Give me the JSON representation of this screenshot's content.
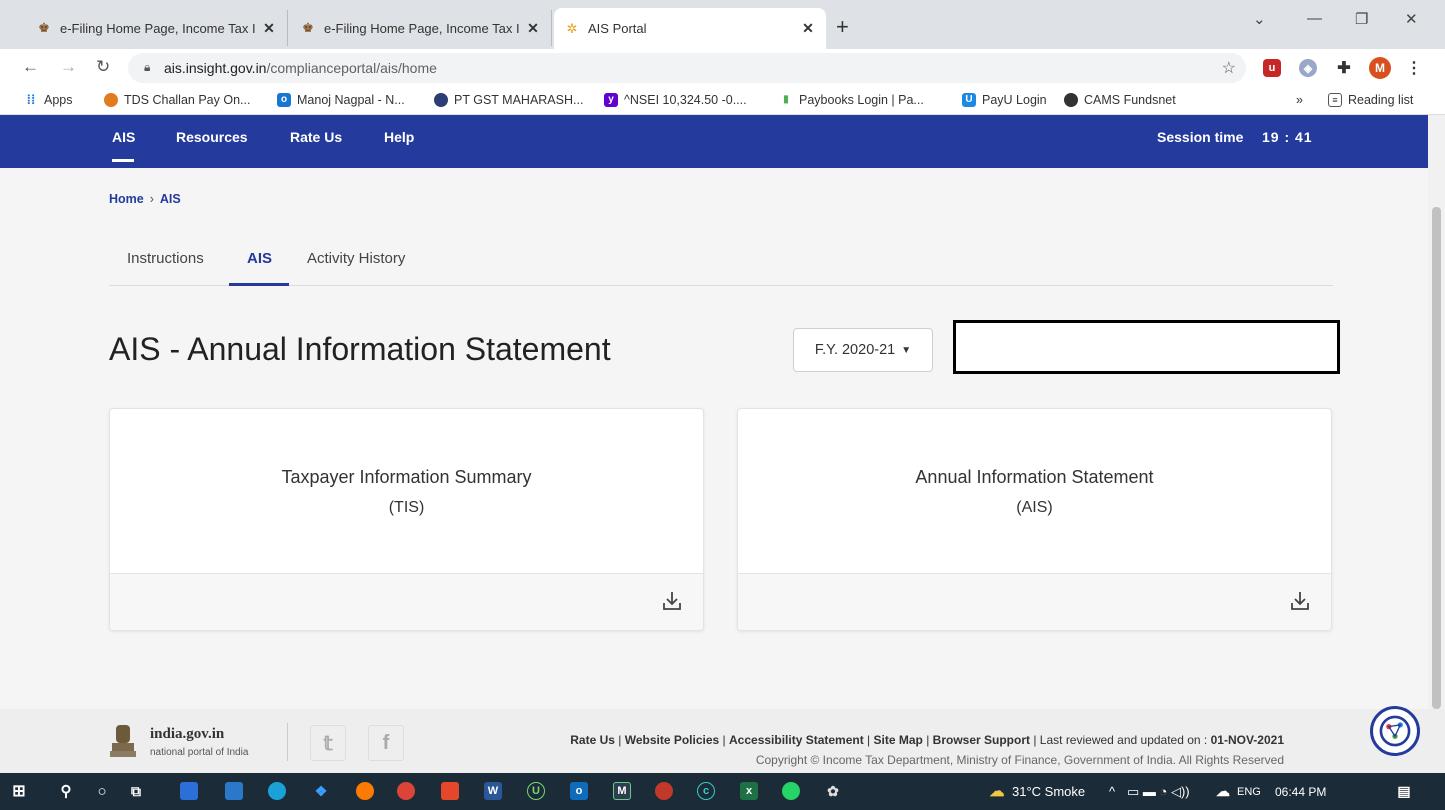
{
  "browser": {
    "tabs": [
      {
        "title": "e-Filing Home Page, Income Tax I",
        "active": false
      },
      {
        "title": "e-Filing Home Page, Income Tax I",
        "active": false
      },
      {
        "title": "AIS Portal",
        "active": true
      }
    ],
    "url_domain": "ais.insight.gov.in",
    "url_path": "/complianceportal/ais/home",
    "profile_initial": "M",
    "bookmarks": [
      {
        "label": "Apps"
      },
      {
        "label": "TDS Challan Pay On..."
      },
      {
        "label": "Manoj Nagpal - N..."
      },
      {
        "label": "PT GST MAHARASH..."
      },
      {
        "label": "^NSEI 10,324.50 -0...."
      },
      {
        "label": "Paybooks Login | Pa..."
      },
      {
        "label": "PayU Login"
      },
      {
        "label": "CAMS Fundsnet"
      }
    ],
    "reading_list": "Reading list",
    "overflow": "»"
  },
  "nav": {
    "items": [
      "AIS",
      "Resources",
      "Rate Us",
      "Help"
    ],
    "session_label": "Session time",
    "session_value": "19 : 41"
  },
  "breadcrumb": {
    "home": "Home",
    "sep": "›",
    "current": "AIS"
  },
  "page_tabs": [
    "Instructions",
    "AIS",
    "Activity History"
  ],
  "page": {
    "title": "AIS - Annual Information Statement",
    "fy_label": "F.Y. 2020-21"
  },
  "cards": [
    {
      "title": "Taxpayer Information Summary",
      "subtitle": "(TIS)"
    },
    {
      "title": "Annual Information Statement",
      "subtitle": "(AIS)"
    }
  ],
  "footer": {
    "site": "india.gov.in",
    "site_sub": "national portal of India",
    "links": [
      "Rate Us",
      "Website Policies",
      "Accessibility Statement",
      "Site Map",
      "Browser Support"
    ],
    "updated_label": "Last reviewed and updated on :",
    "updated_date": "01-NOV-2021",
    "copyright": "Copyright © Income Tax Department, Ministry of Finance, Government of India. All Rights Reserved"
  },
  "taskbar": {
    "weather": "31°C Smoke",
    "lang": "ENG",
    "time": "06:44 PM"
  },
  "colors": {
    "brand": "#243a9c",
    "page_bg": "#f5f5f5"
  }
}
